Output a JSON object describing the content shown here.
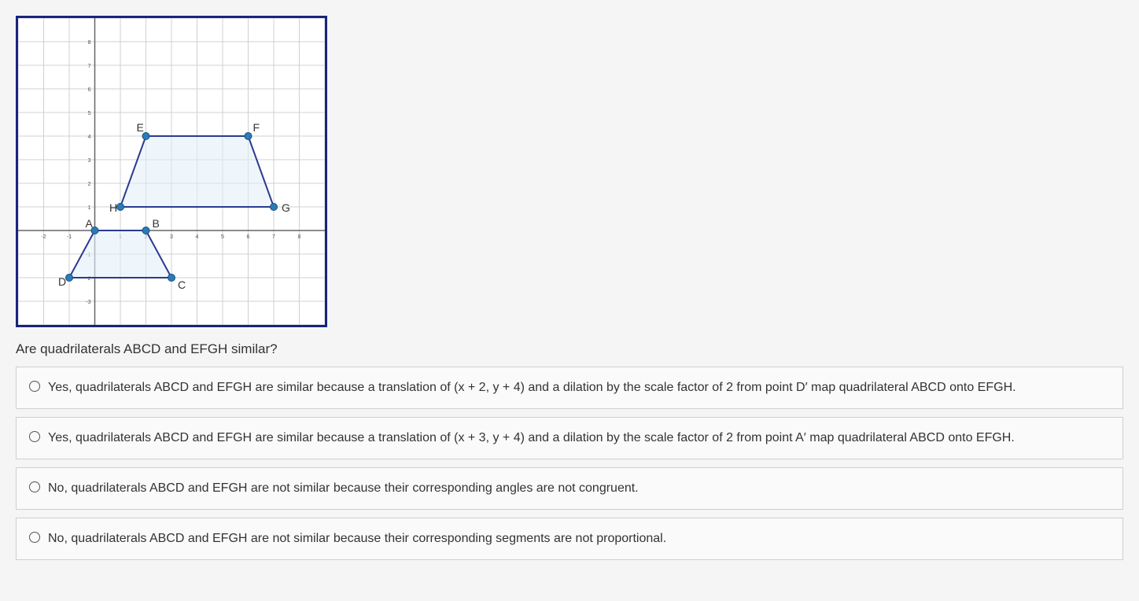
{
  "question": "Are quadrilaterals ABCD and EFGH similar?",
  "options": [
    "Yes, quadrilaterals ABCD and EFGH are similar because a translation of (x + 2, y + 4) and a dilation by the scale factor of 2 from point D′ map quadrilateral ABCD onto EFGH.",
    "Yes, quadrilaterals ABCD and EFGH are similar because a translation of (x + 3, y + 4) and a dilation by the scale factor of 2 from point A′ map quadrilateral ABCD onto EFGH.",
    "No, quadrilaterals ABCD and EFGH are not similar because their corresponding angles are not congruent.",
    "No, quadrilaterals ABCD and EFGH are not similar because their corresponding segments are not proportional."
  ],
  "chart_data": {
    "type": "scatter",
    "title": "",
    "xlabel": "",
    "ylabel": "",
    "xlim": [
      -3,
      9
    ],
    "ylim": [
      -4,
      9
    ],
    "grid": true,
    "shapes": [
      {
        "name": "ABCD",
        "fill": "#e3f0f8",
        "points": [
          {
            "label": "A",
            "x": 0,
            "y": 0
          },
          {
            "label": "B",
            "x": 2,
            "y": 0
          },
          {
            "label": "C",
            "x": 3,
            "y": -2
          },
          {
            "label": "D",
            "x": -1,
            "y": -2
          }
        ]
      },
      {
        "name": "EFGH",
        "fill": "#e3f0f8",
        "points": [
          {
            "label": "E",
            "x": 2,
            "y": 4
          },
          {
            "label": "F",
            "x": 6,
            "y": 4
          },
          {
            "label": "G",
            "x": 7,
            "y": 1
          },
          {
            "label": "H",
            "x": 1,
            "y": 1
          }
        ]
      }
    ],
    "point_labels": {
      "A": "A",
      "B": "B",
      "C": "C",
      "D": "D",
      "E": "E",
      "F": "F",
      "G": "G",
      "H": "H"
    },
    "axis_ticks_x": [
      -2,
      -1,
      1,
      2,
      3,
      4,
      5,
      6,
      7,
      8
    ],
    "axis_ticks_y": [
      -3,
      -2,
      -1,
      1,
      2,
      3,
      4,
      5,
      6,
      7,
      8
    ]
  }
}
